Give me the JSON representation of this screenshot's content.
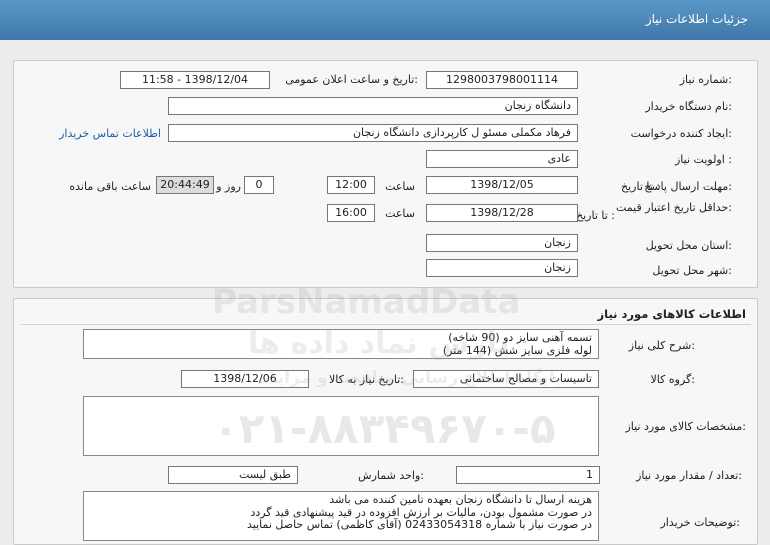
{
  "header": {
    "title": "جزئیات اطلاعات نیاز"
  },
  "form": {
    "need_number": {
      "label": "شماره نیاز:",
      "value": "1298003798001114"
    },
    "announce": {
      "label": "تاریخ و ساعت اعلان عمومی:",
      "value": "1398/12/04 - 11:58"
    },
    "buyer": {
      "label": "نام دستگاه خریدار:",
      "value": "دانشگاه زنجان"
    },
    "requester": {
      "label": "ایجاد کننده درخواست:",
      "value": "فرهاد مکملی مسئو ل کارپردازی دانشگاه زنجان",
      "contact_link": "اطلاعات تماس خریدار"
    },
    "priority": {
      "label": "اولویت نیاز :",
      "value": "عادی"
    },
    "deadline": {
      "label": "مهلت ارسال پاسخ:",
      "to_date_label": "تا تاریخ :",
      "date": "1398/12/05",
      "time_label": "ساعت",
      "time": "12:00",
      "days": "0",
      "days_label": "روز و",
      "remaining": "20:44:49",
      "remaining_label": "ساعت باقی مانده"
    },
    "validity": {
      "label": "حداقل تاریخ اعتبار قیمت:",
      "to_date_label": "تا تاریخ :",
      "date": "1398/12/28",
      "time_label": "ساعت",
      "time": "16:00"
    },
    "province": {
      "label": "استان محل تحویل:",
      "value": "زنجان"
    },
    "city": {
      "label": "شهر محل تحویل:",
      "value": "زنجان"
    }
  },
  "goods": {
    "section_title": "اطلاعات کالاهای مورد نیاز",
    "summary_label": "شرح کلی نیاز:",
    "summary_lines": [
      "تسمه آهنی سایز دو (90 شاخه)",
      "لوله فلزی سایز شش (144 متر)"
    ],
    "group_label": "گروه کالا:",
    "group_value": "تاسیسات و مصالح ساختمانی",
    "need_date_label": "تاریخ نیاز به کالا:",
    "need_date": "1398/12/06",
    "spec_label": "مشخصات کالای مورد نیاز:",
    "qty_label": "تعداد / مقدار مورد نیاز:",
    "qty_value": "1",
    "unit_label": "واحد شمارش:",
    "unit_value": "طبق لیست",
    "notes_label": "توضیحات خریدار:",
    "notes_lines": [
      "هزینه ارسال تا دانشگاه زنجان بعهده تامین کننده می باشد",
      "در صورت مشمول بودن، مالیات بر ارزش افزوده در قید پیشنهادی قید گردد",
      "در صورت نیاز با شماره 02433054318 (آقای کاظمی) تماس حاصل نمایید"
    ]
  },
  "watermark": {
    "brand": "ParsNamadData",
    "persian": "پارس نماد داده ها",
    "subtitle": "پایگاه اطلاع رسانی مناقصه و مزایده",
    "phone": "۰۲۱-۸۸۳۴۹۶۷۰-۵"
  },
  "colors": {
    "header_bg": "#4a86b5",
    "link": "#1a5fa8"
  }
}
